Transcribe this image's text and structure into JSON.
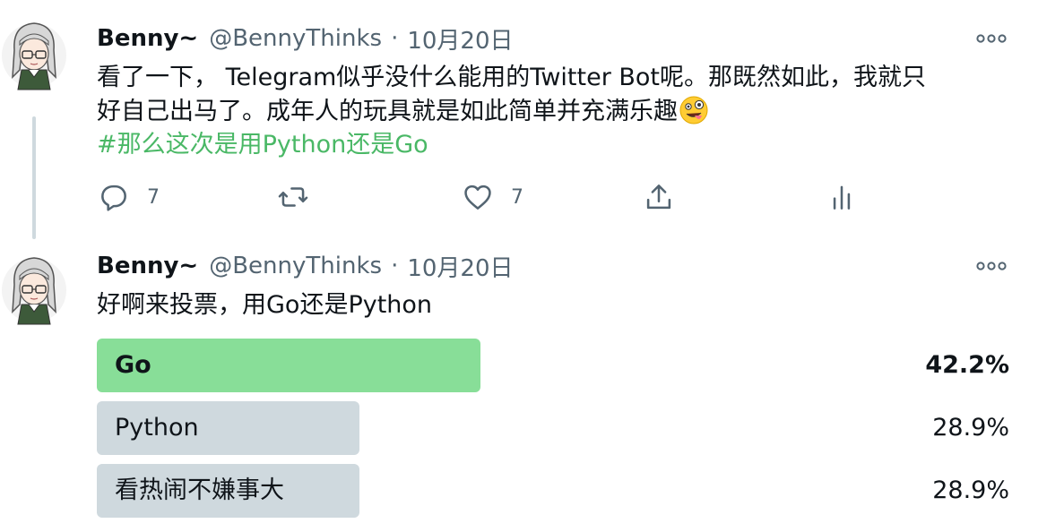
{
  "tweets": [
    {
      "author": {
        "name": "Benny~",
        "handle": "@BennyThinks",
        "separator": "·",
        "date": "10月20日"
      },
      "text_line1": "看了一下， Telegram似乎没什么能用的Twitter Bot呢。那既然如此，我就只",
      "text_line2": "好自己出马了。成年人的玩具就是如此简单并充满乐趣",
      "emoji": "zany-face",
      "hashtag": "#那么这次是用Python还是Go",
      "actions": {
        "reply_count": "7",
        "like_count": "7"
      }
    },
    {
      "author": {
        "name": "Benny~",
        "handle": "@BennyThinks",
        "separator": "·",
        "date": "10月20日"
      },
      "text": "好啊来投票，用Go还是Python",
      "poll": {
        "options": [
          {
            "label": "Go",
            "percent_text": "42.2%",
            "percent": 42.2,
            "winner": true
          },
          {
            "label": "Python",
            "percent_text": "28.9%",
            "percent": 28.9,
            "winner": false
          },
          {
            "label": "看热闹不嫌事大",
            "percent_text": "28.9%",
            "percent": 28.9,
            "winner": false
          }
        ]
      }
    }
  ],
  "colors": {
    "poll_winner": "#88de98",
    "poll_other": "#cfd9de",
    "hashtag": "#4ab866",
    "secondary_text": "#536471",
    "thread_line": "#cfd9de"
  }
}
